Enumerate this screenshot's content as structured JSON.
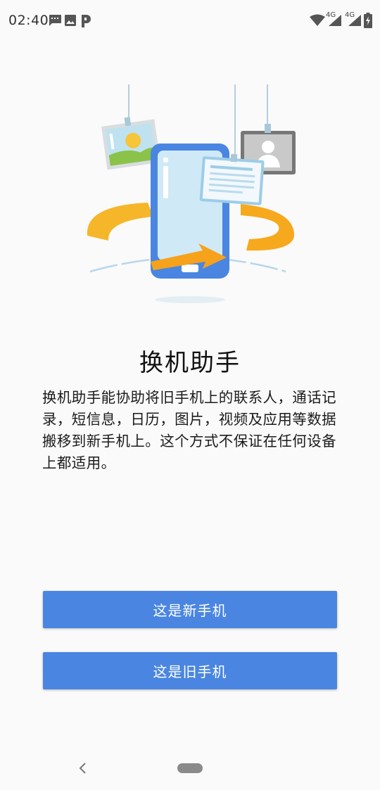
{
  "status_bar": {
    "time": "02:40",
    "left_icons": [
      "message-icon",
      "image-icon",
      "parking-icon"
    ],
    "network_label_1": "4G",
    "network_label_2": "4G",
    "right_icons": [
      "wifi-icon",
      "signal-icon",
      "signal-icon",
      "battery-charging-icon"
    ]
  },
  "illustration": {
    "icons": [
      "phone-icon",
      "photo-card-icon",
      "contact-card-icon",
      "document-card-icon",
      "transfer-arrow-icon"
    ]
  },
  "main": {
    "title": "换机助手",
    "description": "换机助手能协助将旧手机上的联系人，通话记录，短信息，日历，图片，视频及应用等数据搬移到新手机上。这个方式不保证在任何设备上都适用。"
  },
  "buttons": {
    "new_phone": "这是新手机",
    "old_phone": "这是旧手机"
  },
  "nav_bar": {
    "icons": [
      "back-icon",
      "home-pill-icon"
    ]
  },
  "colors": {
    "accent": "#4a86e1",
    "background": "#fafafa",
    "arrow": "#f5a21b"
  }
}
